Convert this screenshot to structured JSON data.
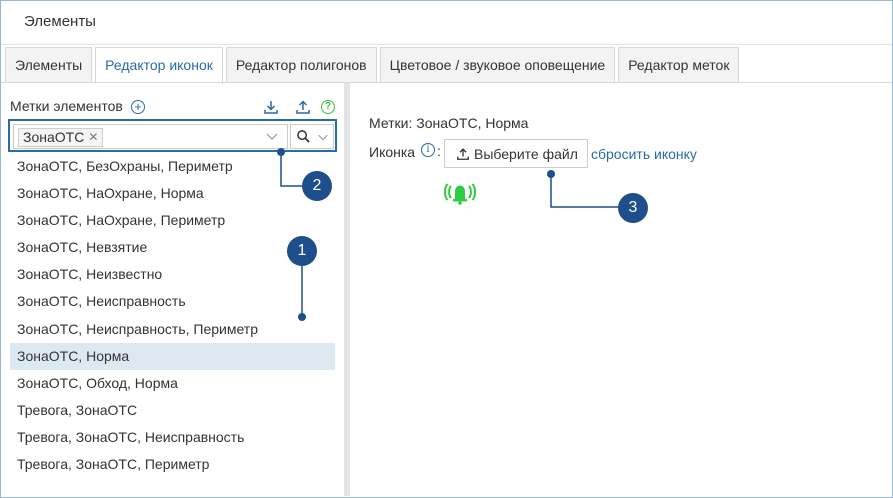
{
  "window": {
    "title": "Элементы"
  },
  "tabs": [
    {
      "label": "Элементы",
      "active": false
    },
    {
      "label": "Редактор иконок",
      "active": true
    },
    {
      "label": "Редактор полигонов",
      "active": false
    },
    {
      "label": "Цветовое / звуковое оповещение",
      "active": false
    },
    {
      "label": "Редактор меток",
      "active": false
    }
  ],
  "left_panel": {
    "header_label": "Метки элементов",
    "icons": {
      "add": "plus-circle-icon",
      "download": "download-icon",
      "upload": "upload-icon",
      "help": "help-icon"
    },
    "selected_chip": "ЗонаОТС",
    "items": [
      "ЗонаОТС, БезОхраны, Периметр",
      "ЗонаОТС, НаОхране, Норма",
      "ЗонаОТС, НаОхране, Периметр",
      "ЗонаОТС, Невзятие",
      "ЗонаОТС, Неизвестно",
      "ЗонаОТС, Неисправность",
      "ЗонаОТС, Неисправность, Периметр",
      "ЗонаОТС, Норма",
      "ЗонаОТС, Обход, Норма",
      "Тревога, ЗонаОТС",
      "Тревога, ЗонаОТС, Неисправность",
      "Тревога, ЗонаОТС, Периметр"
    ],
    "selected_index": 7
  },
  "right_panel": {
    "labels_text": "Метки: ЗонаОТС, Норма",
    "icon_label": "Иконка",
    "colon": ":",
    "choose_file_label": "Выберите файл",
    "reset_icon_label": "сбросить иконку",
    "preview_icon": "alarm-bell-icon"
  },
  "callouts": [
    "1",
    "2",
    "3"
  ],
  "colors": {
    "accent": "#2a6aa8",
    "callout": "#1f4e8c",
    "bell": "#2ecc40",
    "selected_row": "#dde9f1",
    "help": "#3bbf3b"
  }
}
